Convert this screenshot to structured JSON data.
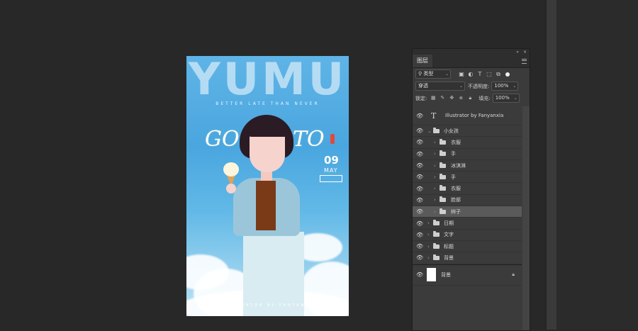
{
  "poster": {
    "big_title": "YUMU",
    "tagline": "BETTER LATE THAN NEVER",
    "script_title_left": "GO",
    "script_title_right": "TO",
    "day": "09",
    "month": "MAY",
    "date_box": "",
    "credit": "ILLUSTRATOR BY FANYANXIA",
    "colors": {
      "sky_top": "#5fb4e6",
      "sky_bottom": "#bfe3f4"
    }
  },
  "panel": {
    "collapse_icon": "double-chevron-icon",
    "close_icon": "close-icon",
    "tab_label": "图层",
    "filter_select": "类型",
    "filter_icons": [
      "image-filter-icon",
      "adjustment-filter-icon",
      "text-filter-icon",
      "shape-filter-icon",
      "smart-object-filter-icon"
    ],
    "blend_mode": "穿透",
    "opacity_label": "不透明度:",
    "opacity_value": "100%",
    "lock_label": "锁定:",
    "fill_label": "填充:",
    "fill_value": "100%",
    "layers": {
      "text_layer": "Illustrator by Fanyanxia",
      "group_girl": "小女孩",
      "sub": [
        "衣服",
        "手",
        "冰淇淋",
        "手",
        "衣服",
        "脸部",
        "辫子"
      ],
      "top_groups": [
        "日期",
        "文字",
        "标题",
        "背景"
      ],
      "background": "背景"
    },
    "selected_layer": "辫子"
  }
}
